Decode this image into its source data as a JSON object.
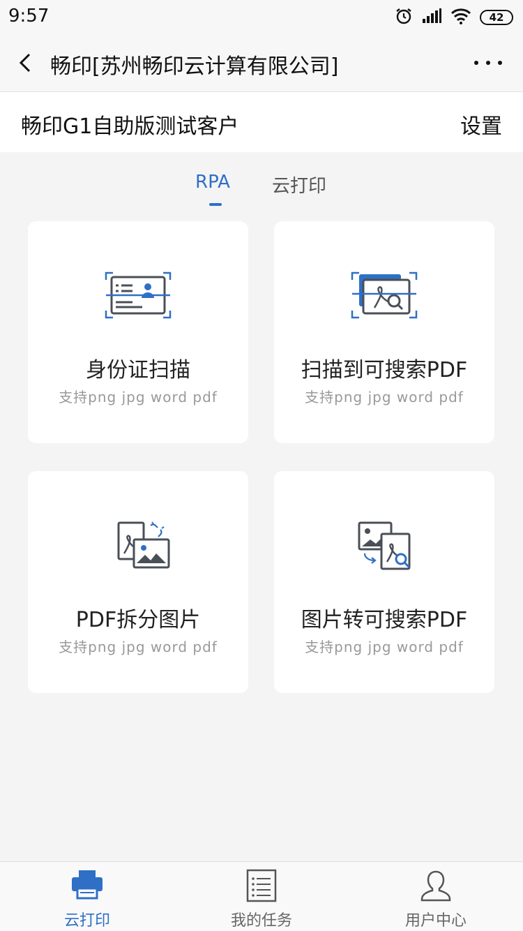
{
  "status_bar": {
    "time": "9:57",
    "battery": "42",
    "icons": [
      "alarm-icon",
      "signal-icon",
      "wifi-icon",
      "battery-icon"
    ]
  },
  "nav": {
    "title": "畅印[苏州畅印云计算有限公司]",
    "back_icon": "chevron-left-icon",
    "more_icon": "more-dots-icon"
  },
  "client": {
    "name": "畅印G1自助版测试客户",
    "settings_label": "设置"
  },
  "tabs": [
    {
      "label": "RPA",
      "active": true
    },
    {
      "label": "云打印",
      "active": false
    }
  ],
  "cards": [
    {
      "title": "身份证扫描",
      "subtitle": "支持png jpg word pdf",
      "icon": "id-card-scan-icon"
    },
    {
      "title": "扫描到可搜索PDF",
      "subtitle": "支持png jpg word pdf",
      "icon": "scan-searchable-pdf-icon"
    },
    {
      "title": "PDF拆分图片",
      "subtitle": "支持png jpg word pdf",
      "icon": "pdf-split-image-icon"
    },
    {
      "title": "图片转可搜索PDF",
      "subtitle": "支持png jpg word pdf",
      "icon": "image-to-searchable-pdf-icon"
    }
  ],
  "bottom_nav": [
    {
      "label": "云打印",
      "icon": "printer-icon",
      "active": true
    },
    {
      "label": "我的任务",
      "icon": "task-list-icon",
      "active": false
    },
    {
      "label": "用户中心",
      "icon": "user-icon",
      "active": false
    }
  ],
  "colors": {
    "accent": "#2f6fc5",
    "icon_gray": "#4a4f57",
    "background": "#f4f4f5"
  }
}
